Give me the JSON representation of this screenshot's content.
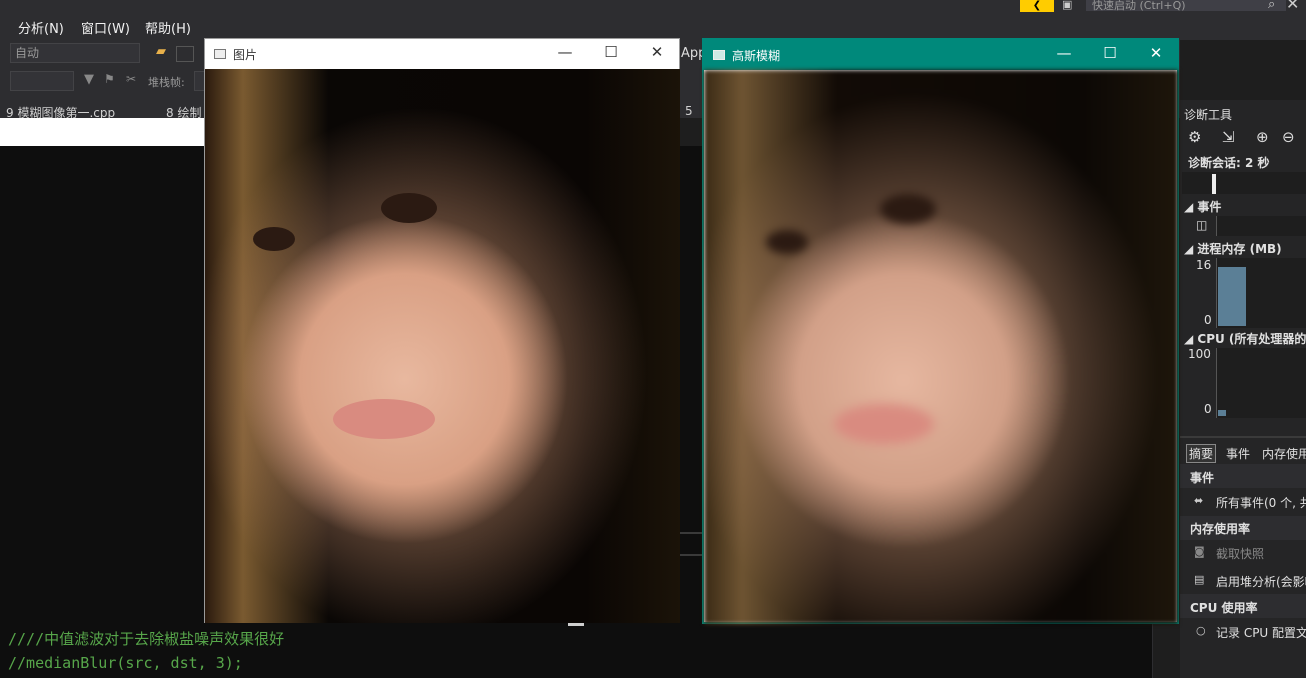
{
  "menu": {
    "items": [
      "分析(N)",
      "窗口(W)",
      "帮助(H)"
    ]
  },
  "quick_launch": {
    "placeholder": "快速启动 (Ctrl+Q)"
  },
  "toolbar": {
    "auto_combo": "自动",
    "stack_label": "堆栈帧:",
    "app_text": "App"
  },
  "editor_tabs": [
    "9 模糊图像第一.cpp",
    "8 绘制",
    "5"
  ],
  "code_lines": [
    "////中值滤波对于去除椒盐噪声效果很好",
    "//medianBlur(src, dst, 3);"
  ],
  "window_original": {
    "title": "图片"
  },
  "window_blur": {
    "title": "高斯模糊"
  },
  "diagnostics": {
    "title": "诊断工具",
    "session": "诊断会话: 2 秒",
    "events_header": "事件",
    "memory_header": "进程内存 (MB)",
    "memory_max": "16",
    "memory_min": "0",
    "memory_level": 0.9,
    "cpu_header": "CPU (所有处理器的百",
    "cpu_max": "100",
    "cpu_min": "0",
    "tabs": [
      "摘要",
      "事件",
      "内存使用"
    ],
    "summary_events": "事件",
    "all_events": "所有事件(0 个, 共",
    "memory_usage": "内存使用率",
    "snapshot": "截取快照",
    "heap_analysis": "启用堆分析(会影响",
    "cpu_usage": "CPU 使用率",
    "record_cpu": "记录 CPU 配置文"
  },
  "colors": {
    "blur_window_border": "#00897b",
    "accent": "#ffcc00"
  }
}
